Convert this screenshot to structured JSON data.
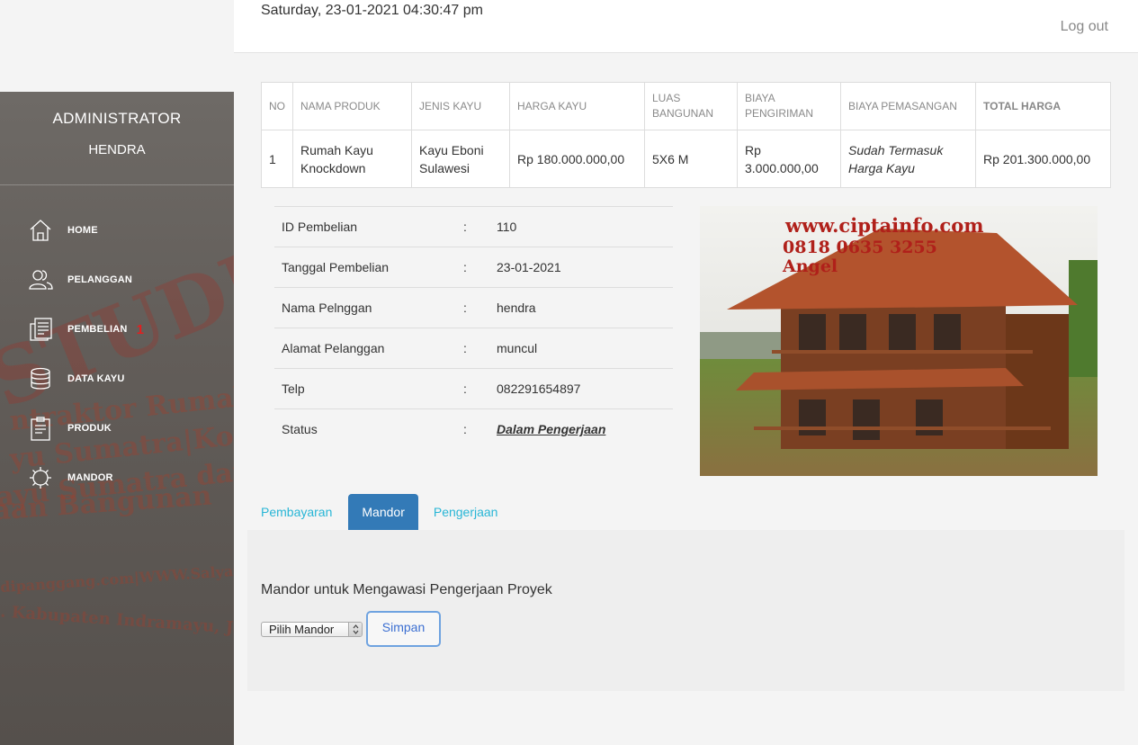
{
  "header": {
    "datetime": "Saturday, 23-01-2021 04:30:47 pm",
    "logout_label": "Log out"
  },
  "sidebar": {
    "role": "ADMINISTRATOR",
    "user": "HENDRA",
    "items": [
      {
        "label": "HOME",
        "icon": "home-icon"
      },
      {
        "label": "PELANGGAN",
        "icon": "users-icon"
      },
      {
        "label": "PEMBELIAN",
        "icon": "document-icon",
        "badge": "1"
      },
      {
        "label": "DATA KAYU",
        "icon": "database-icon"
      },
      {
        "label": "PRODUK",
        "icon": "clipboard-icon"
      },
      {
        "label": "MANDOR",
        "icon": "gear-icon"
      }
    ]
  },
  "product_table": {
    "headers": {
      "no": "NO",
      "nama_produk": "NAMA PRODUK",
      "jenis_kayu": "JENIS KAYU",
      "harga_kayu": "HARGA KAYU",
      "luas_1": "LUAS",
      "luas_2": "BANGUNAN",
      "biaya_kirim_1": "BIAYA",
      "biaya_kirim_2": "PENGIRIMAN",
      "biaya_pasang": "BIAYA PEMASANGAN",
      "total": "TOTAL HARGA"
    },
    "row": {
      "no": "1",
      "nama_1": "Rumah Kayu",
      "nama_2": "Knockdown",
      "jenis_1": "Kayu Eboni",
      "jenis_2": "Sulawesi",
      "harga": "Rp 180.000.000,00",
      "luas": "5X6 M",
      "kirim_1": "Rp",
      "kirim_2": "3.000.000,00",
      "pasang_1": "Sudah Termasuk",
      "pasang_2": "Harga Kayu",
      "total": "Rp 201.300.000,00"
    }
  },
  "details": {
    "colon": ":",
    "rows": [
      {
        "label": "ID Pembelian",
        "value": "110"
      },
      {
        "label": "Tanggal Pembelian",
        "value": "23-01-2021"
      },
      {
        "label": "Nama Pelnggan",
        "value": "hendra"
      },
      {
        "label": "Alamat Pelanggan",
        "value": "muncul"
      },
      {
        "label": "Telp",
        "value": "082291654897"
      },
      {
        "label": "Status",
        "value": "Dalam Pengerjaan"
      }
    ]
  },
  "photo": {
    "line1": "www.ciptainfo.com",
    "line2": "0818 0635 3255",
    "line3": "Angel"
  },
  "tabs": [
    {
      "label": "Pembayaran"
    },
    {
      "label": "Mandor"
    },
    {
      "label": "Pengerjaan"
    }
  ],
  "mandor_panel": {
    "heading": "Mandor untuk Mengawasi Pengerjaan Proyek",
    "select_value": "Pilih Mandor",
    "save_label": "Simpan"
  },
  "colors": {
    "accent": "#337ab7",
    "tab_link": "#29b6d6",
    "badge": "#e02020"
  }
}
